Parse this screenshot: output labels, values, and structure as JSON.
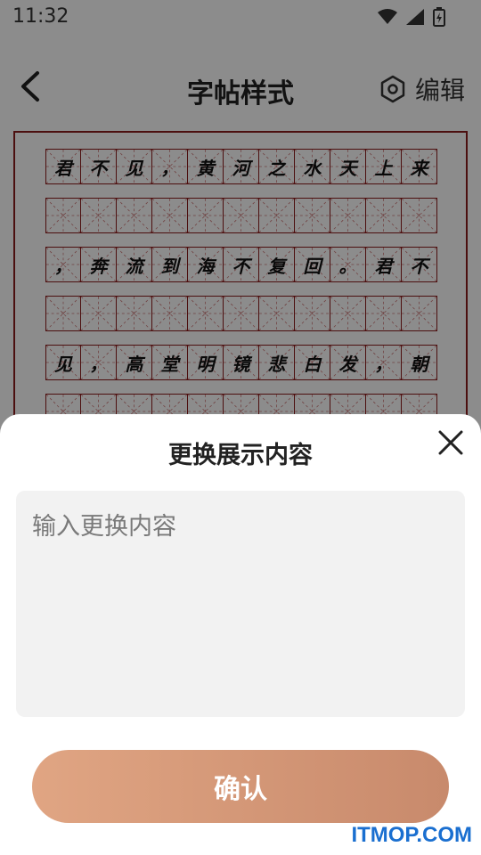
{
  "status_bar": {
    "time": "11:32"
  },
  "header": {
    "title": "字帖样式",
    "edit_label": "编辑"
  },
  "sheet": {
    "rows": [
      [
        "君",
        "不",
        "见",
        "，",
        "黄",
        "河",
        "之",
        "水",
        "天",
        "上",
        "来"
      ],
      [
        "",
        "",
        "",
        "",
        "",
        "",
        "",
        "",
        "",
        "",
        ""
      ],
      [
        "，",
        "奔",
        "流",
        "到",
        "海",
        "不",
        "复",
        "回",
        "。",
        "君",
        "不"
      ],
      [
        "",
        "",
        "",
        "",
        "",
        "",
        "",
        "",
        "",
        "",
        ""
      ],
      [
        "见",
        "，",
        "高",
        "堂",
        "明",
        "镜",
        "悲",
        "白",
        "发",
        "，",
        "朝"
      ],
      [
        "",
        "",
        "",
        "",
        "",
        "",
        "",
        "",
        "",
        "",
        ""
      ]
    ]
  },
  "dialog": {
    "title": "更换展示内容",
    "input_placeholder": "输入更换内容",
    "input_value": "",
    "confirm_label": "确认"
  },
  "watermark": "ITMOP.COM",
  "colors": {
    "grid": "#8a1d1d",
    "button_start": "#e0a583",
    "button_end": "#c88a6c",
    "watermark": "#1a6fd0"
  }
}
